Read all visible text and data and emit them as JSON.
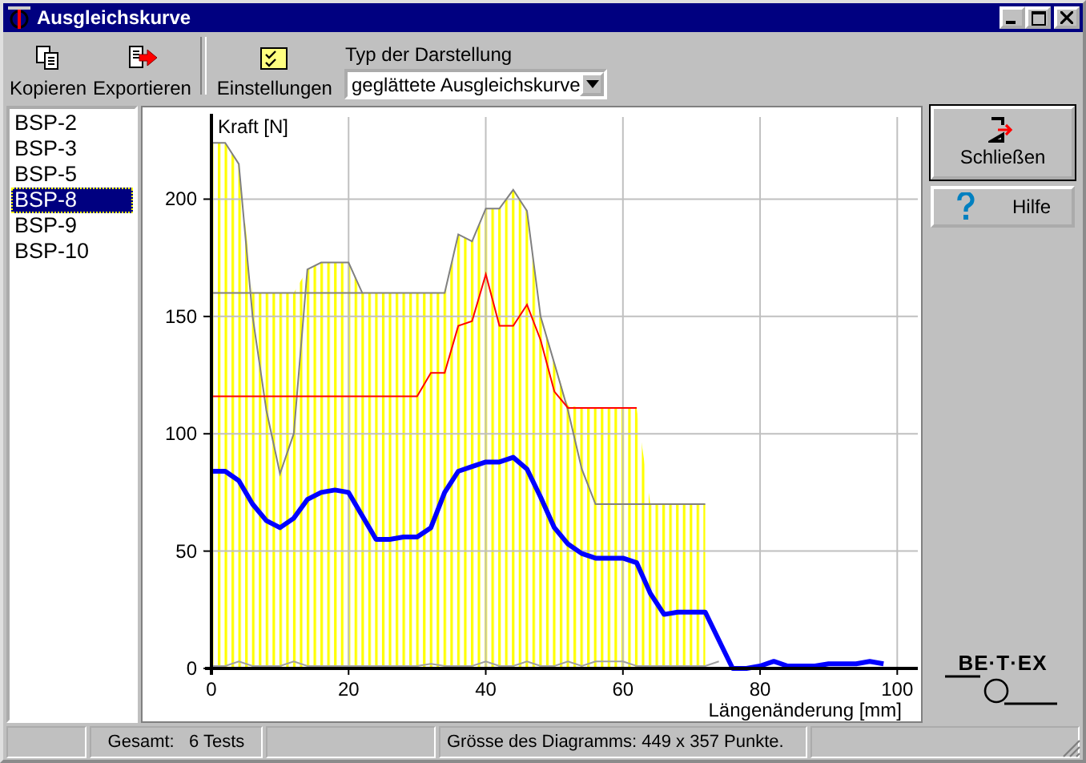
{
  "window": {
    "title": "Ausgleichskurve"
  },
  "toolbar": {
    "buttons": [
      {
        "label": "Kopieren",
        "kind": "copy"
      },
      {
        "label": "Exportieren",
        "kind": "export"
      },
      {
        "label": "Einstellungen",
        "kind": "settings"
      }
    ],
    "display_type": {
      "label": "Typ der Darstellung",
      "value": "geglättete Ausgleichskurve"
    }
  },
  "samples": [
    {
      "label": "BSP-2",
      "selected": false
    },
    {
      "label": "BSP-3",
      "selected": false
    },
    {
      "label": "BSP-5",
      "selected": false
    },
    {
      "label": "BSP-8",
      "selected": true
    },
    {
      "label": "BSP-9",
      "selected": false
    },
    {
      "label": "BSP-10",
      "selected": false
    }
  ],
  "chart": {
    "chart_data": {
      "type": "line",
      "xlabel": "Längenänderung [mm]",
      "ylabel": "Kraft [N]",
      "xlim": [
        0,
        103
      ],
      "ylim": [
        0,
        235
      ],
      "xticks": [
        0,
        20,
        40,
        60,
        80,
        100
      ],
      "yticks": [
        0,
        50,
        100,
        150,
        200
      ],
      "grid": true,
      "x": [
        0,
        2,
        4,
        6,
        8,
        10,
        12,
        14,
        16,
        18,
        20,
        22,
        24,
        26,
        28,
        30,
        32,
        34,
        36,
        38,
        40,
        42,
        44,
        46,
        48,
        50,
        52,
        54,
        56,
        58,
        60,
        62,
        64,
        66,
        68,
        70,
        72,
        74,
        76,
        78,
        80,
        82,
        84,
        86,
        88,
        90,
        92,
        94,
        96,
        98
      ],
      "series": [
        {
          "type": "area",
          "color": "#ffff00",
          "values": [
            224,
            224,
            215,
            160,
            160,
            160,
            160,
            170,
            173,
            173,
            173,
            160,
            160,
            160,
            160,
            160,
            160,
            160,
            185,
            182,
            196,
            196,
            204,
            195,
            150,
            130,
            112,
            111,
            111,
            111,
            111,
            111,
            70,
            70,
            70,
            70,
            70,
            null,
            null,
            null,
            null,
            null,
            null,
            null,
            null,
            null,
            null,
            null,
            null,
            null
          ]
        },
        {
          "color": "#808080",
          "values": [
            224,
            224,
            215,
            150,
            110,
            83,
            100,
            170,
            173,
            173,
            173,
            160,
            160,
            160,
            160,
            160,
            160,
            160,
            185,
            182,
            196,
            196,
            204,
            195,
            150,
            130,
            110,
            85,
            70,
            70,
            70,
            70,
            70,
            70,
            70,
            70,
            70,
            null,
            null,
            null,
            null,
            null,
            null,
            null,
            null,
            null,
            null,
            null,
            null,
            null
          ]
        },
        {
          "color": "#808080",
          "values": [
            160,
            160,
            160,
            160,
            160,
            160,
            160,
            160,
            160,
            160,
            160,
            160,
            null,
            null,
            null,
            null,
            null,
            null,
            null,
            null,
            null,
            null,
            null,
            null,
            null,
            null,
            null,
            null,
            null,
            null,
            null,
            null,
            null,
            null,
            null,
            null,
            null,
            null,
            null,
            null,
            null,
            null,
            null,
            null,
            null,
            null,
            null,
            null,
            null,
            null
          ]
        },
        {
          "color": "#ff0000",
          "values": [
            116,
            116,
            116,
            116,
            116,
            116,
            116,
            116,
            116,
            116,
            116,
            116,
            116,
            116,
            116,
            116,
            126,
            126,
            146,
            148,
            168,
            146,
            146,
            155,
            140,
            118,
            111,
            111,
            111,
            111,
            111,
            111,
            null,
            null,
            null,
            null,
            null,
            null,
            null,
            null,
            null,
            null,
            null,
            null,
            null,
            null,
            null,
            null,
            null,
            null
          ]
        },
        {
          "color": "#a0a0a0",
          "values": [
            1,
            1,
            3,
            1,
            1,
            1,
            3,
            1,
            1,
            1,
            1,
            1,
            1,
            1,
            1,
            1,
            2,
            1,
            1,
            1,
            3,
            1,
            1,
            3,
            1,
            1,
            3,
            1,
            3,
            3,
            3,
            1,
            1,
            1,
            1,
            1,
            1,
            3,
            null,
            null,
            null,
            null,
            null,
            null,
            null,
            null,
            null,
            null,
            null,
            null
          ]
        },
        {
          "color": "#0000ff",
          "values": [
            84,
            84,
            80,
            70,
            63,
            60,
            64,
            72,
            75,
            76,
            75,
            65,
            55,
            55,
            56,
            56,
            60,
            75,
            84,
            86,
            88,
            88,
            90,
            85,
            73,
            60,
            53,
            49,
            47,
            47,
            47,
            45,
            32,
            23,
            24,
            24,
            24,
            12,
            0,
            0,
            1,
            3,
            1,
            1,
            1,
            2,
            2,
            2,
            3,
            2
          ]
        }
      ]
    }
  },
  "actions": [
    {
      "label": "Schließen",
      "kind": "close"
    },
    {
      "label": "Hilfe",
      "kind": "help"
    }
  ],
  "logo": {
    "text": "BE·T·EX"
  },
  "status_bar": [
    "Gesamt:   6 Tests",
    "Grösse des Diagramms: 449 x 357 Punkte."
  ]
}
